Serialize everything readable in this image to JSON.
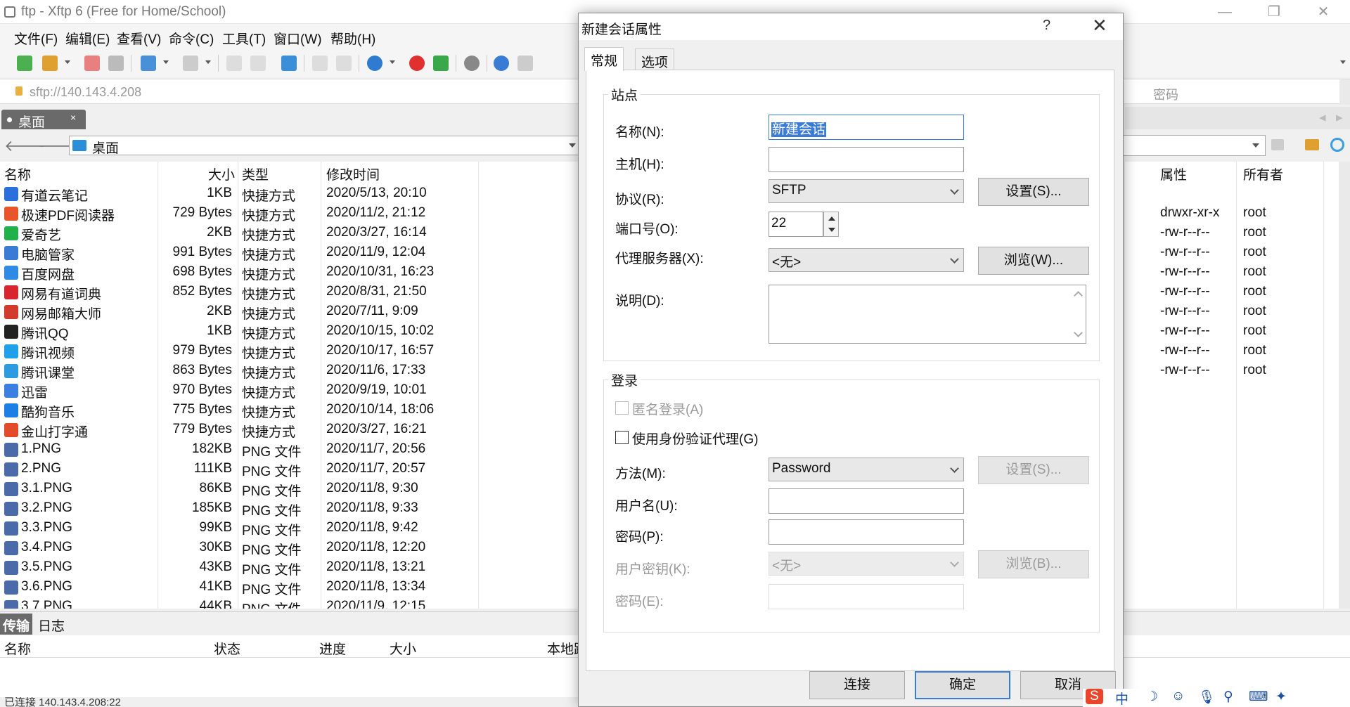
{
  "window": {
    "title": "ftp - Xftp 6 (Free for Home/School)",
    "minimize": "—",
    "maximize": "❐",
    "close": "✕"
  },
  "menu": [
    "文件(F)",
    "编辑(E)",
    "查看(V)",
    "命令(C)",
    "工具(T)",
    "窗口(W)",
    "帮助(H)"
  ],
  "address": {
    "url": "sftp://140.143.4.208",
    "password_placeholder": "密码"
  },
  "local_tab": {
    "label": "桌面",
    "close": "×"
  },
  "local_path": "桌面",
  "columns": {
    "name": "名称",
    "size": "大小",
    "type": "类型",
    "modified": "修改时间"
  },
  "files": [
    {
      "name": "有道云笔记",
      "size": "1KB",
      "type": "快捷方式",
      "modified": "2020/5/13, 20:10",
      "color": "#2a6fdb"
    },
    {
      "name": "极速PDF阅读器",
      "size": "729 Bytes",
      "type": "快捷方式",
      "modified": "2020/11/2, 21:12",
      "color": "#e8552a"
    },
    {
      "name": "爱奇艺",
      "size": "2KB",
      "type": "快捷方式",
      "modified": "2020/3/27, 16:14",
      "color": "#21b14b"
    },
    {
      "name": "电脑管家",
      "size": "991 Bytes",
      "type": "快捷方式",
      "modified": "2020/11/9, 12:04",
      "color": "#3a7bd5"
    },
    {
      "name": "百度网盘",
      "size": "698 Bytes",
      "type": "快捷方式",
      "modified": "2020/10/31, 16:23",
      "color": "#2f8ae6"
    },
    {
      "name": "网易有道词典",
      "size": "852 Bytes",
      "type": "快捷方式",
      "modified": "2020/8/31, 21:50",
      "color": "#d8262e"
    },
    {
      "name": "网易邮箱大师",
      "size": "2KB",
      "type": "快捷方式",
      "modified": "2020/7/11, 9:09",
      "color": "#d33b2c"
    },
    {
      "name": "腾讯QQ",
      "size": "1KB",
      "type": "快捷方式",
      "modified": "2020/10/15, 10:02",
      "color": "#222222"
    },
    {
      "name": "腾讯视频",
      "size": "979 Bytes",
      "type": "快捷方式",
      "modified": "2020/10/17, 16:57",
      "color": "#20a0e8"
    },
    {
      "name": "腾讯课堂",
      "size": "863 Bytes",
      "type": "快捷方式",
      "modified": "2020/11/6, 17:33",
      "color": "#2d9be0"
    },
    {
      "name": "迅雷",
      "size": "970 Bytes",
      "type": "快捷方式",
      "modified": "2020/9/19, 10:01",
      "color": "#3b7fe0"
    },
    {
      "name": "酷狗音乐",
      "size": "775 Bytes",
      "type": "快捷方式",
      "modified": "2020/10/14, 18:06",
      "color": "#1d7fe5"
    },
    {
      "name": "金山打字通",
      "size": "779 Bytes",
      "type": "快捷方式",
      "modified": "2020/3/27, 16:21",
      "color": "#e34c2a"
    },
    {
      "name": "1.PNG",
      "size": "182KB",
      "type": "PNG 文件",
      "modified": "2020/11/7, 20:56",
      "color": "#4a6aa8"
    },
    {
      "name": "2.PNG",
      "size": "111KB",
      "type": "PNG 文件",
      "modified": "2020/11/7, 20:57",
      "color": "#4a6aa8"
    },
    {
      "name": "3.1.PNG",
      "size": "86KB",
      "type": "PNG 文件",
      "modified": "2020/11/8, 9:30",
      "color": "#4a6aa8"
    },
    {
      "name": "3.2.PNG",
      "size": "185KB",
      "type": "PNG 文件",
      "modified": "2020/11/8, 9:33",
      "color": "#4a6aa8"
    },
    {
      "name": "3.3.PNG",
      "size": "99KB",
      "type": "PNG 文件",
      "modified": "2020/11/8, 9:42",
      "color": "#4a6aa8"
    },
    {
      "name": "3.4.PNG",
      "size": "30KB",
      "type": "PNG 文件",
      "modified": "2020/11/8, 12:20",
      "color": "#4a6aa8"
    },
    {
      "name": "3.5.PNG",
      "size": "43KB",
      "type": "PNG 文件",
      "modified": "2020/11/8, 13:21",
      "color": "#4a6aa8"
    },
    {
      "name": "3.6.PNG",
      "size": "41KB",
      "type": "PNG 文件",
      "modified": "2020/11/8, 13:34",
      "color": "#4a6aa8"
    },
    {
      "name": "3.7.PNG",
      "size": "44KB",
      "type": "PNG 文件",
      "modified": "2020/11/9, 12:15",
      "color": "#4a6aa8"
    }
  ],
  "remote": {
    "columns": {
      "attr": "属性",
      "owner": "所有者"
    },
    "rows": [
      {
        "attr": "drwxr-xr-x",
        "owner": "root"
      },
      {
        "attr": "-rw-r--r--",
        "owner": "root"
      },
      {
        "attr": "-rw-r--r--",
        "owner": "root"
      },
      {
        "attr": "-rw-r--r--",
        "owner": "root"
      },
      {
        "attr": "-rw-r--r--",
        "owner": "root"
      },
      {
        "attr": "-rw-r--r--",
        "owner": "root"
      },
      {
        "attr": "-rw-r--r--",
        "owner": "root"
      },
      {
        "attr": "-rw-r--r--",
        "owner": "root"
      },
      {
        "attr": "-rw-r--r--",
        "owner": "root"
      }
    ]
  },
  "bottom": {
    "tabs": {
      "transfer": "传输",
      "log": "日志"
    },
    "columns": {
      "name": "名称",
      "status": "状态",
      "progress": "进度",
      "size": "大小",
      "local": "本地路"
    },
    "status": "已连接 140.143.4.208:22"
  },
  "dialog": {
    "title": "新建会话属性",
    "help": "?",
    "close": "✕",
    "tabs": {
      "general": "常规",
      "options": "选项"
    },
    "site": {
      "legend": "站点",
      "name_label": "名称(N):",
      "name_value": "新建会话",
      "host_label": "主机(H):",
      "host_value": "",
      "protocol_label": "协议(R):",
      "protocol_value": "SFTP",
      "protocol_settings": "设置(S)...",
      "port_label": "端口号(O):",
      "port_value": "22",
      "proxy_label": "代理服务器(X):",
      "proxy_value": "<无>",
      "proxy_browse": "浏览(W)...",
      "desc_label": "说明(D):"
    },
    "login": {
      "legend": "登录",
      "anonymous": "匿名登录(A)",
      "agent": "使用身份验证代理(G)",
      "method_label": "方法(M):",
      "method_value": "Password",
      "method_settings": "设置(S)...",
      "user_label": "用户名(U):",
      "user_value": "",
      "password_label": "密码(P):",
      "password_value": "",
      "userkey_label": "用户密钥(K):",
      "userkey_value": "<无>",
      "userkey_browse": "浏览(B)...",
      "passphrase_label": "密码(E):"
    },
    "buttons": {
      "connect": "连接",
      "ok": "确定",
      "cancel": "取消"
    }
  },
  "ime": {
    "logo": "S",
    "lang": "中"
  }
}
